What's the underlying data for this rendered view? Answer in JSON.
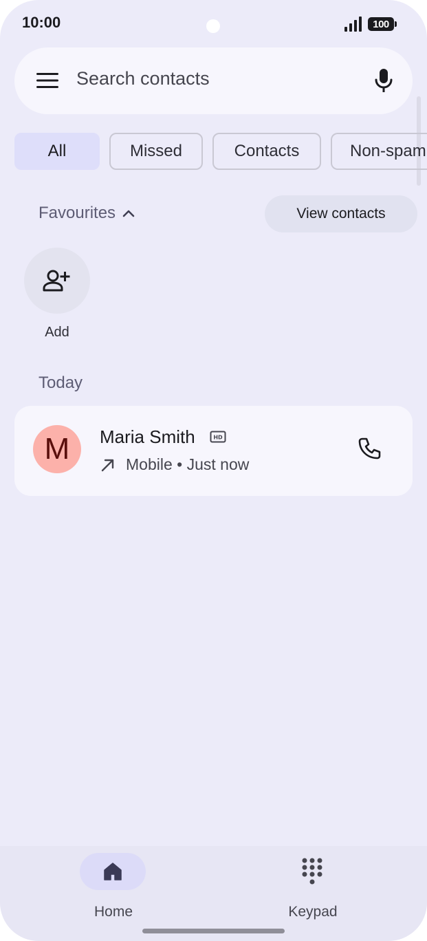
{
  "status_bar": {
    "time": "10:00",
    "battery": "100",
    "icons": [
      "signal-icon",
      "battery-icon"
    ]
  },
  "search": {
    "placeholder": "Search contacts",
    "icons": [
      "menu-icon",
      "mic-icon"
    ]
  },
  "filters": {
    "chips": [
      {
        "label": "All",
        "selected": true
      },
      {
        "label": "Missed",
        "selected": false
      },
      {
        "label": "Contacts",
        "selected": false
      },
      {
        "label": "Non-spam",
        "selected": false
      }
    ]
  },
  "favourites": {
    "title": "Favourites",
    "view_contacts_label": "View contacts",
    "add_label": "Add"
  },
  "call_log": {
    "section_title": "Today",
    "entries": [
      {
        "initial": "M",
        "name": "Maria Smith",
        "detail": "Mobile • Just now",
        "avatar_color": "#fcb1aa"
      }
    ]
  },
  "bottom_nav": {
    "items": [
      {
        "label": "Home",
        "active": true
      },
      {
        "label": "Keypad",
        "active": false
      }
    ]
  },
  "colors": {
    "background": "#ecebf9",
    "surface": "#f7f6fd",
    "selected_chip": "#dedefa",
    "accent_text": "#5d5c74"
  }
}
